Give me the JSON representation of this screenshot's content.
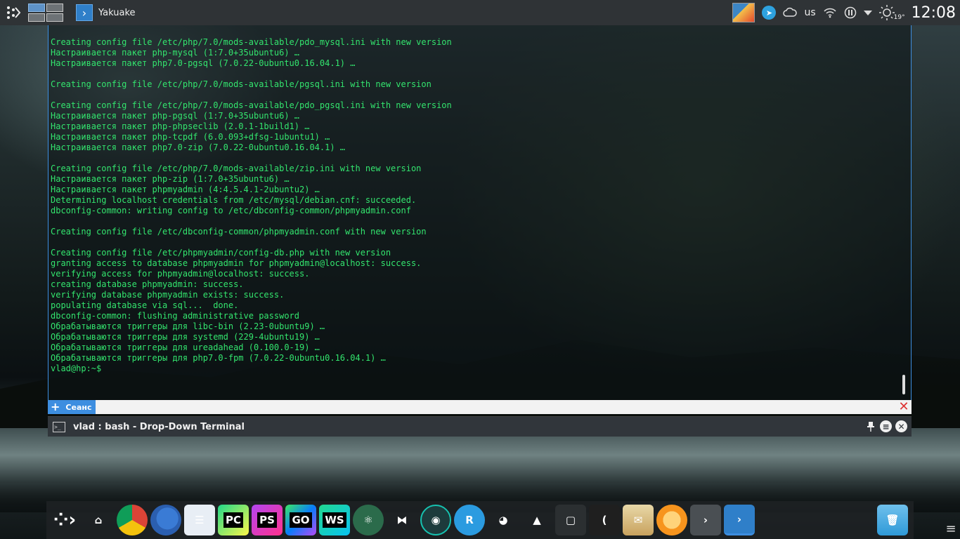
{
  "top_panel": {
    "app_label": "Yakuake",
    "keyboard_layout": "us",
    "temperature": "19°",
    "clock": "12:08"
  },
  "terminal": {
    "lines": [
      "Creating config file /etc/php/7.0/mods-available/pdo_mysql.ini with new version",
      "Настраивается пакет php-mysql (1:7.0+35ubuntu6) …",
      "Настраивается пакет php7.0-pgsql (7.0.22-0ubuntu0.16.04.1) …",
      "",
      "Creating config file /etc/php/7.0/mods-available/pgsql.ini with new version",
      "",
      "Creating config file /etc/php/7.0/mods-available/pdo_pgsql.ini with new version",
      "Настраивается пакет php-pgsql (1:7.0+35ubuntu6) …",
      "Настраивается пакет php-phpseclib (2.0.1-1build1) …",
      "Настраивается пакет php-tcpdf (6.0.093+dfsg-1ubuntu1) …",
      "Настраивается пакет php7.0-zip (7.0.22-0ubuntu0.16.04.1) …",
      "",
      "Creating config file /etc/php/7.0/mods-available/zip.ini with new version",
      "Настраивается пакет php-zip (1:7.0+35ubuntu6) …",
      "Настраивается пакет phpmyadmin (4:4.5.4.1-2ubuntu2) …",
      "Determining localhost credentials from /etc/mysql/debian.cnf: succeeded.",
      "dbconfig-common: writing config to /etc/dbconfig-common/phpmyadmin.conf",
      "",
      "Creating config file /etc/dbconfig-common/phpmyadmin.conf with new version",
      "",
      "Creating config file /etc/phpmyadmin/config-db.php with new version",
      "granting access to database phpmyadmin for phpmyadmin@localhost: success.",
      "verifying access for phpmyadmin@localhost: success.",
      "creating database phpmyadmin: success.",
      "verifying database phpmyadmin exists: success.",
      "populating database via sql...  done.",
      "dbconfig-common: flushing administrative password",
      "Обрабатываются триггеры для libc-bin (2.23-0ubuntu9) …",
      "Обрабатываются триггеры для systemd (229-4ubuntu19) …",
      "Обрабатываются триггеры для ureadahead (0.100.0-19) …",
      "Обрабатываются триггеры для php7.0-fpm (7.0.22-0ubuntu0.16.04.1) …",
      "vlad@hp:~$"
    ],
    "text_color": "#33e56e"
  },
  "session_bar": {
    "tab_label": "Сеанс"
  },
  "title_bar": {
    "title": "vlad : bash - Drop-Down Terminal"
  },
  "dock": {
    "items": [
      {
        "icon": "plasma-launcher-icon",
        "label": ""
      },
      {
        "icon": "home-folder-icon",
        "label": ""
      },
      {
        "icon": "chrome-icon",
        "label": ""
      },
      {
        "icon": "firefox-icon",
        "label": ""
      },
      {
        "icon": "text-editor-icon",
        "label": ""
      },
      {
        "icon": "pycharm-icon",
        "label": "PC"
      },
      {
        "icon": "phpstorm-icon",
        "label": "PS"
      },
      {
        "icon": "goland-icon",
        "label": "GO"
      },
      {
        "icon": "webstorm-icon",
        "label": "WS"
      },
      {
        "icon": "atom-icon",
        "label": ""
      },
      {
        "icon": "vscode-icon",
        "label": ""
      },
      {
        "icon": "gitkraken-icon",
        "label": ""
      },
      {
        "icon": "r-app-icon",
        "label": ""
      },
      {
        "icon": "gimp-icon",
        "label": ""
      },
      {
        "icon": "inkscape-icon",
        "label": ""
      },
      {
        "icon": "notes-icon",
        "label": ""
      },
      {
        "icon": "kate-icon",
        "label": ""
      },
      {
        "icon": "mail-icon",
        "label": ""
      },
      {
        "icon": "vlc-orange-icon",
        "label": ""
      },
      {
        "icon": "terminal-icon",
        "label": ""
      },
      {
        "icon": "yakuake-icon",
        "label": ""
      },
      {
        "icon": "trash-folder-icon",
        "label": ""
      }
    ]
  },
  "colors": {
    "accent": "#3d8ee0",
    "panel_bg": "#2f3336"
  }
}
